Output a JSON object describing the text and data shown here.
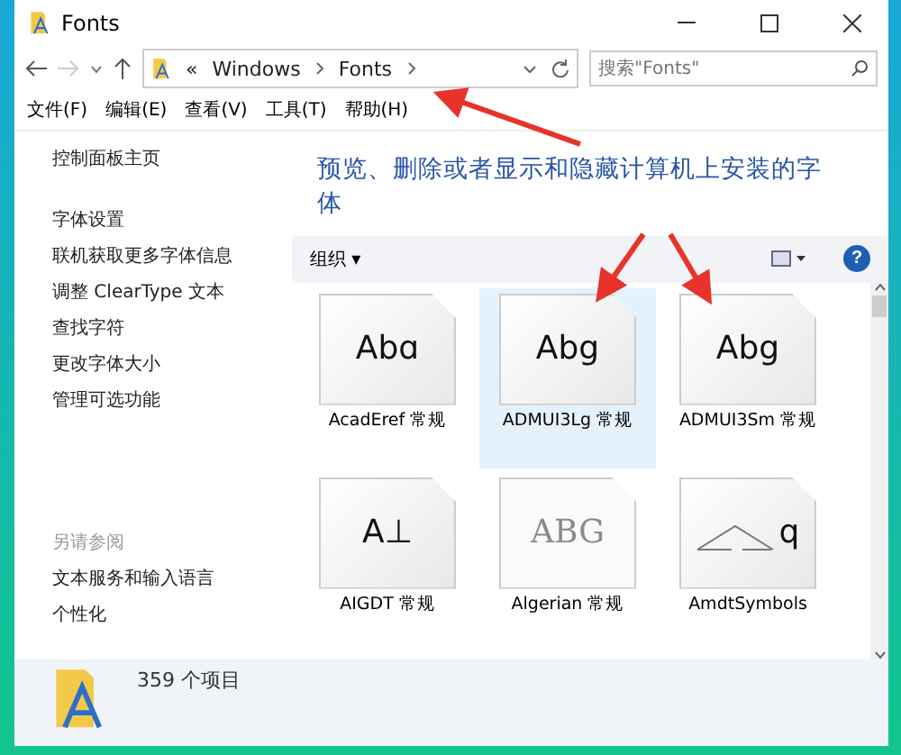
{
  "window": {
    "title": "Fonts"
  },
  "address_bar": {
    "prefix": "«",
    "path": [
      "Windows",
      "Fonts"
    ]
  },
  "search": {
    "placeholder": "搜索\"Fonts\""
  },
  "menu": [
    "文件(F)",
    "编辑(E)",
    "查看(V)",
    "工具(T)",
    "帮助(H)"
  ],
  "sidebar": {
    "home": "控制面板主页",
    "items": [
      "字体设置",
      "联机获取更多字体信息",
      "调整 ClearType 文本",
      "查找字符",
      "更改字体大小",
      "管理可选功能"
    ],
    "see_also_title": "另请参阅",
    "see_also": [
      "文本服务和输入语言",
      "个性化"
    ]
  },
  "headline": "预览、删除或者显示和隐藏计算机上安装的字体",
  "toolbar": {
    "organize": "组织 ▾",
    "help": "?"
  },
  "fonts": [
    {
      "name": "AcadEref 常规",
      "kind": "text",
      "sample": "Abɑ",
      "selected": false,
      "hidden": false
    },
    {
      "name": "ADMUI3Lg 常规",
      "kind": "text",
      "sample": "Abg",
      "selected": true,
      "hidden": false
    },
    {
      "name": "ADMUI3Sm 常规",
      "kind": "text",
      "sample": "Abg",
      "selected": false,
      "hidden": false
    },
    {
      "name": "AIGDT 常规",
      "kind": "text",
      "sample": "A⊥",
      "selected": false,
      "hidden": false
    },
    {
      "name": "Algerian 常规",
      "kind": "text",
      "sample": "ABG",
      "selected": false,
      "hidden": true
    },
    {
      "name": "AmdtSymbols",
      "kind": "symbol",
      "sample": "q",
      "selected": false,
      "hidden": false
    }
  ],
  "details": {
    "count": "359 个项目"
  }
}
